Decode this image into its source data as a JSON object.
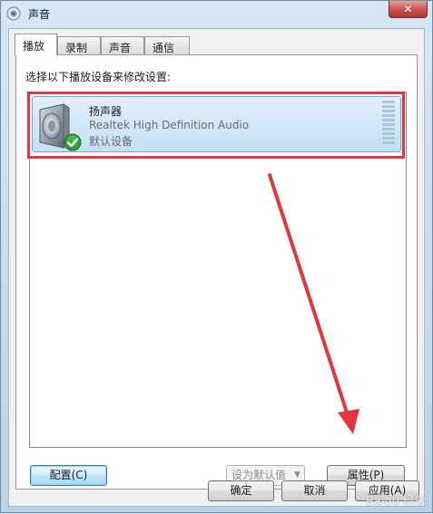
{
  "window": {
    "title": "声音",
    "close_label": "✕"
  },
  "tabs": [
    {
      "label": "播放",
      "active": true
    },
    {
      "label": "录制",
      "active": false
    },
    {
      "label": "声音",
      "active": false
    },
    {
      "label": "通信",
      "active": false
    }
  ],
  "playback": {
    "instruction": "选择以下播放设备来修改设置:",
    "devices": [
      {
        "name": "扬声器",
        "description": "Realtek High Definition Audio",
        "status": "默认设备",
        "icon": "speaker-icon",
        "badge": "check-icon",
        "selected": true
      }
    ],
    "buttons": {
      "configure": "配置(C)",
      "set_default": "设为默认值(S)",
      "properties": "属性(P)"
    }
  },
  "footer": {
    "ok": "确定",
    "cancel": "取消",
    "apply": "应用(A)"
  },
  "watermark": "Baidu 经验",
  "colors": {
    "highlight": "#e2363f",
    "arrow": "#e2363f",
    "selection": "#c4dff6"
  }
}
